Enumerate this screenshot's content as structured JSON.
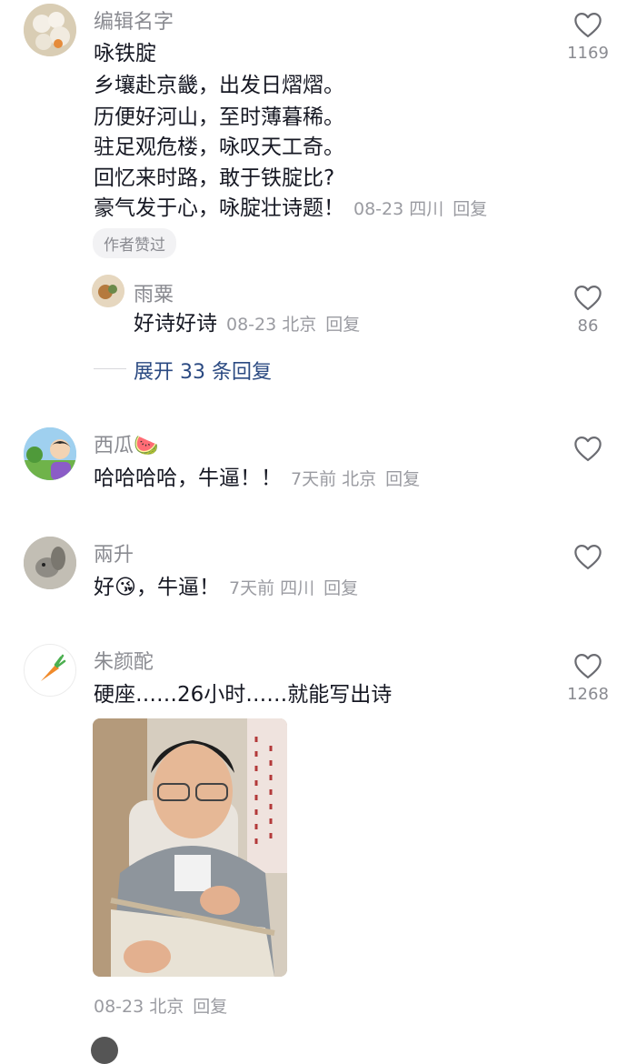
{
  "comments": [
    {
      "name": "编辑名字",
      "lines": [
        "咏铁腚",
        "乡壤赴京畿，出发日熠熠。",
        "历便好河山，至时薄暮稀。",
        "驻足观危楼，咏叹天工奇。",
        "回忆来时路，敢于铁腚比?",
        "豪气发于心，咏腚壮诗题！"
      ],
      "meta": "08-23 四川",
      "reply": "回复",
      "likes": "1169",
      "badge": "作者赞过"
    },
    {
      "name": "雨粟",
      "text": "好诗好诗",
      "meta": "08-23 北京",
      "reply": "回复",
      "likes": "86"
    },
    {
      "name": "西瓜🍉",
      "text": "哈哈哈哈，牛逼！！",
      "meta": "7天前 北京",
      "reply": "回复"
    },
    {
      "name": "兩升",
      "text": "好😘，牛逼！",
      "meta": "7天前 四川",
      "reply": "回复"
    },
    {
      "name": "朱颜酡",
      "text": "硬座……26小时……就能写出诗",
      "meta": "08-23 北京",
      "reply": "回复",
      "likes": "1268"
    }
  ],
  "expand_replies": "展开 33 条回复",
  "icons": {
    "like": "heart-outline-icon",
    "avatar5": "carrot-icon"
  },
  "colors": {
    "text": "#161823",
    "muted": "#8a8b91",
    "link": "#2b4a82"
  }
}
